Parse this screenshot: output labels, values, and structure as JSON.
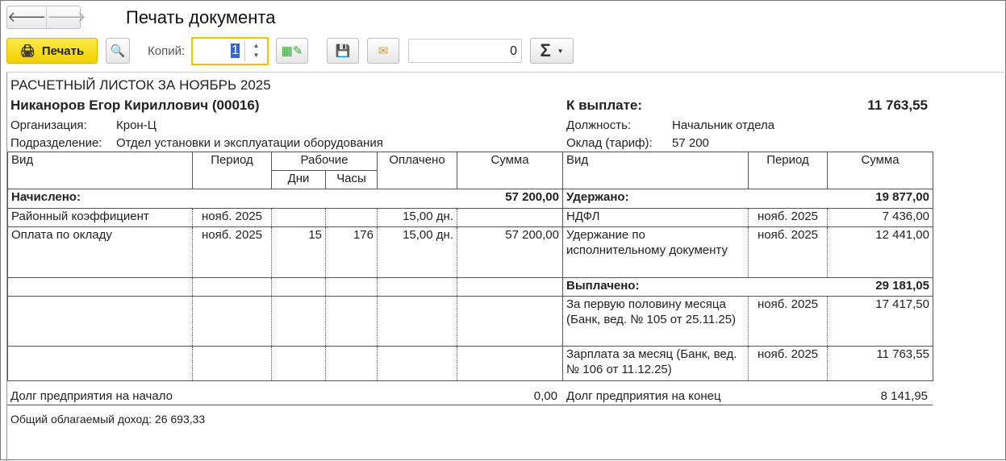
{
  "window": {
    "title": "Печать документа"
  },
  "toolbar": {
    "print_label": "Печать",
    "copies_label": "Копий:",
    "copies_value": "1",
    "counter_value": "0",
    "sum_symbol": "Σ"
  },
  "sheet": {
    "heading": "РАСЧЕТНЫЙ ЛИСТОК ЗА НОЯБРЬ 2025",
    "employee": "Никаноров Егор Кириллович (00016)",
    "pay_label": "К выплате:",
    "pay_value": "11 763,55",
    "org_label": "Организация:",
    "org_value": "Крон-Ц",
    "dept_label": "Подразделение:",
    "dept_value": "Отдел установки и эксплуатации оборудования",
    "pos_label": "Должность:",
    "pos_value": "Начальник отдела",
    "salary_label": "Оклад (тариф):",
    "salary_value": "57 200",
    "headers": {
      "kind": "Вид",
      "period": "Период",
      "work": "Рабочие",
      "days": "Дни",
      "hours": "Часы",
      "paid": "Оплачено",
      "sum": "Сумма",
      "kind2": "Вид",
      "period2": "Период",
      "sum2": "Сумма"
    },
    "accrued_label": "Начислено:",
    "accrued_total": "57 200,00",
    "withheld_label": "Удержано:",
    "withheld_total": "19 877,00",
    "accruals": [
      {
        "kind": "Районный коэффициент",
        "period": "нояб. 2025",
        "days": "",
        "hours": "",
        "paid": "15,00 дн.",
        "sum": ""
      },
      {
        "kind": "Оплата по окладу",
        "period": "нояб. 2025",
        "days": "15",
        "hours": "176",
        "paid": "15,00 дн.",
        "sum": "57 200,00"
      }
    ],
    "deductions": [
      {
        "kind": "НДФЛ",
        "period": "нояб. 2025",
        "sum": "7 436,00"
      },
      {
        "kind": "Удержание по исполнительному документу",
        "period": "нояб. 2025",
        "sum": "12 441,00"
      }
    ],
    "paid_label": "Выплачено:",
    "paid_total": "29 181,05",
    "payouts": [
      {
        "kind": "За первую половину месяца (Банк, вед. № 105 от 25.11.25)",
        "period": "нояб. 2025",
        "sum": "17 417,50"
      },
      {
        "kind": "Зарплата за месяц (Банк, вед. № 106 от 11.12.25)",
        "period": "нояб. 2025",
        "sum": "11 763,55"
      }
    ],
    "debt_start_label": "Долг предприятия на начало",
    "debt_start_value": "0,00",
    "debt_end_label": "Долг предприятия на конец",
    "debt_end_value": "8 141,95",
    "taxable_income": "Общий облагаемый доход: 26 693,33"
  }
}
